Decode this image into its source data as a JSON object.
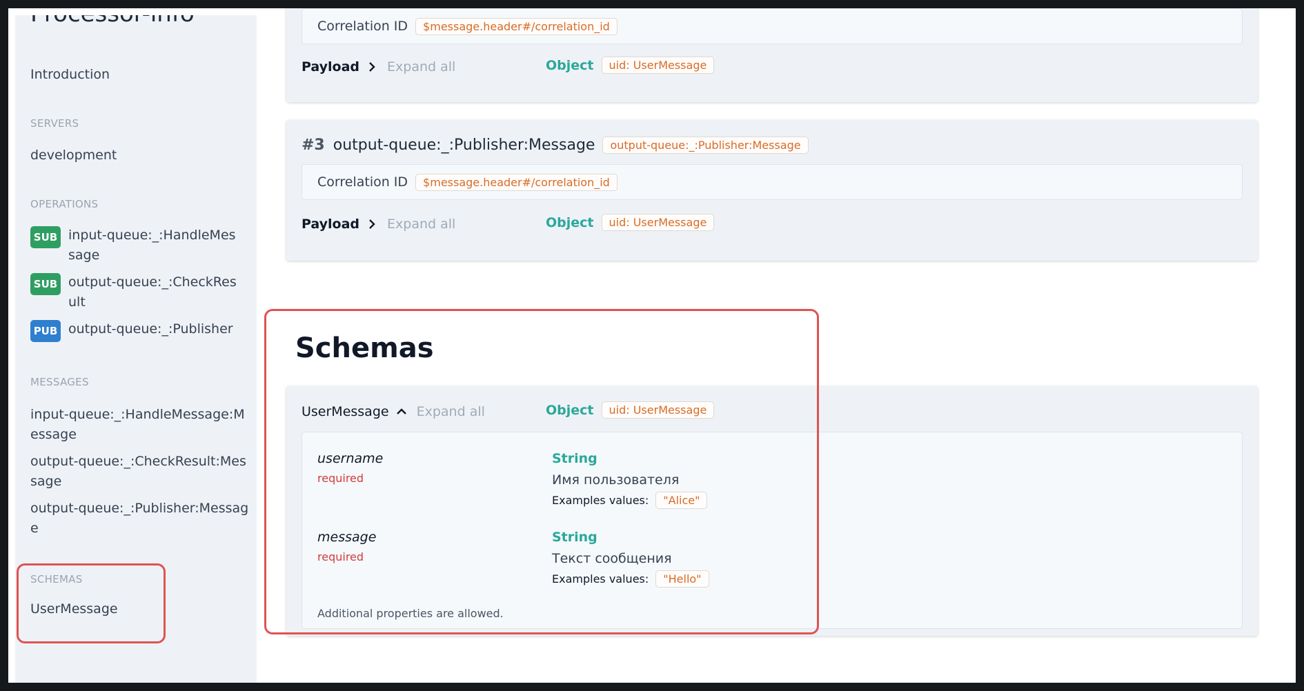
{
  "sidebar": {
    "app_title": "Processor-info",
    "introduction": "Introduction",
    "servers_heading": "SERVERS",
    "servers": [
      "development"
    ],
    "operations_heading": "OPERATIONS",
    "operations": [
      {
        "badge": "SUB",
        "label": "input-queue:_:HandleMessage"
      },
      {
        "badge": "SUB",
        "label": "output-queue:_:CheckResult"
      },
      {
        "badge": "PUB",
        "label": "output-queue:_:Publisher"
      }
    ],
    "messages_heading": "MESSAGES",
    "messages": [
      "input-queue:_:HandleMessage:Message",
      "output-queue:_:CheckResult:Message",
      "output-queue:_:Publisher:Message"
    ],
    "schemas_heading": "SCHEMAS",
    "schemas": [
      "UserMessage"
    ]
  },
  "messages_section": {
    "message_2": {
      "correlation_label": "Correlation ID",
      "correlation_value": "$message.header#/correlation_id",
      "payload_label": "Payload",
      "expand_all": "Expand all",
      "type": "Object",
      "uid": "uid: UserMessage"
    },
    "message_3": {
      "number": "#3",
      "name": "output-queue:_:Publisher:Message",
      "name_tag": "output-queue:_:Publisher:Message",
      "correlation_label": "Correlation ID",
      "correlation_value": "$message.header#/correlation_id",
      "payload_label": "Payload",
      "expand_all": "Expand all",
      "type": "Object",
      "uid": "uid: UserMessage"
    }
  },
  "schemas_section": {
    "title": "Schemas",
    "schema": {
      "name": "UserMessage",
      "expand_all": "Expand all",
      "type": "Object",
      "uid": "uid: UserMessage",
      "properties": [
        {
          "name": "username",
          "required": "required",
          "type": "String",
          "description": "Имя пользователя",
          "examples_label": "Examples values:",
          "example": "\"Alice\""
        },
        {
          "name": "message",
          "required": "required",
          "type": "String",
          "description": "Текст сообщения",
          "examples_label": "Examples values:",
          "example": "\"Hello\""
        }
      ],
      "additional": "Additional properties are allowed."
    }
  },
  "colors": {
    "highlight": "#e05252",
    "type_teal": "#2aa89a",
    "tag_orange": "#d96b26",
    "sub_badge": "#2f9e62",
    "pub_badge": "#2f7fcf"
  }
}
